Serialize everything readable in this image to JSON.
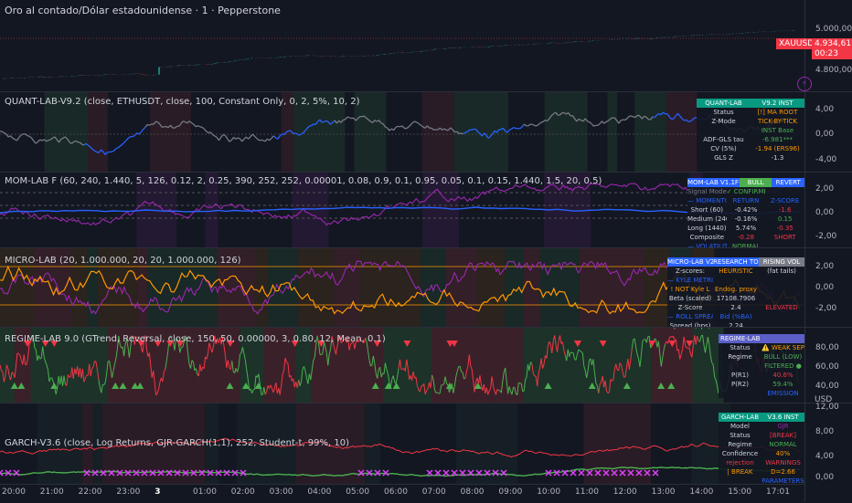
{
  "header": {
    "title": "Oro al contado/Dólar estadounidense · 1 · Pepperstone",
    "currency": "USD"
  },
  "price_pane": {
    "symbol": "XAUUSD",
    "last": "4.934,61",
    "countdown": "00:23",
    "ticks": [
      "5.000,00",
      "4.800,00"
    ]
  },
  "quant": {
    "title": "QUANT-LAB-V9.2 (close, ETHUSDT, close, 100, Constant Only, 0, 2, 5%, 10, 2)",
    "ticks": [
      "4,00",
      "0,00",
      "-4,00"
    ],
    "table": {
      "h1": "QUANT-LAB",
      "h2": "V9.2 INST",
      "rows": [
        [
          "Status",
          "[!] MA ROOT"
        ],
        [
          "Z-Mode",
          "TICK-BY-TICK"
        ],
        [
          "",
          "INST Base"
        ],
        [
          "ADF-GLS tau",
          "-6.981***"
        ],
        [
          "CV (5%)",
          "-1.94 (ERS96)"
        ],
        [
          "GLS Z",
          "-1.3"
        ]
      ]
    }
  },
  "mom": {
    "title": "MOM-LAB F (60, 240, 1.440, 5, 126, 0.12, 2, 0.25, 390, 252, 252, 0.00001, 0.08, 0.9, 0.1, 0.95, 0.05, 0.1, 0.15, 1.440, 1.5, 20, 0.5)",
    "ticks": [
      "2,00",
      "0,00",
      "-2,00"
    ],
    "table": {
      "h1": "MOM-LAB V1.1F-A",
      "h2": "BULL",
      "h3": "REVERT",
      "rows": [
        [
          "Signal Mode",
          "✓ CONFIRMED",
          ""
        ],
        [
          "— MOMENTUM —",
          "RETURN",
          "Z-SCORE"
        ],
        [
          "Short (60)",
          "-0.42%",
          "-1.6"
        ],
        [
          "Medium (240)",
          "-0.16%",
          "0.15"
        ],
        [
          "Long (1440)",
          "5.74%",
          "-0.35"
        ],
        [
          "Composite",
          "-0.28",
          "SHORT"
        ],
        [
          "— VOLATILITY —",
          "NORMAL",
          ""
        ]
      ]
    }
  },
  "micro": {
    "title": "MICRO-LAB (20, 1.000.000, 20, 20, 1.000.000, 126)",
    "ticks": [
      "2,00",
      "0,00",
      "-2,00"
    ],
    "table": {
      "h1": "MICRO-LAB V2.1",
      "h2": "RESEARCH TOOL",
      "h3": "RISING VOL",
      "rows": [
        [
          "Z-scores:",
          "HEURISTIC",
          "(fat tails)"
        ],
        [
          "— KYLE METRIC —",
          "",
          ""
        ],
        [
          "! NOT Kyle L",
          "Endog. proxy",
          ""
        ],
        [
          "Beta (scaled)",
          "17108.7906",
          ""
        ],
        [
          "Z-Score",
          "2.4",
          "ELEVATED"
        ],
        [
          "— ROLL SPREAD —",
          "Bid (%BA)",
          ""
        ],
        [
          "Spread (bps)",
          "2.24",
          ""
        ]
      ]
    }
  },
  "regime": {
    "title": "REGIME-LAB 9.0 (GTrend, Reversal, close, 150, 50, 0.00000, 3, 0.80, 12, Mean, 0.1)",
    "ticks": [
      "80,00",
      "60,00",
      "40,00",
      "20,00"
    ],
    "table": {
      "h1": "REGIME-LAB",
      "rows": [
        [
          "Status",
          "⚠️ WEAK SEP"
        ],
        [
          "Regime",
          "BULL (LOW)"
        ],
        [
          "",
          "FILTERED ●"
        ],
        [
          "P(R1)",
          "40.6%"
        ],
        [
          "P(R2)",
          "59.4%"
        ],
        [
          "",
          "EMISSION"
        ]
      ]
    }
  },
  "garch": {
    "title": "GARCH-V3.6 (close, Log Returns, GJR-GARCH(1,1), 252, Student-t, 99%, 10)",
    "ticks": [
      "12,00",
      "8,00",
      "4,00",
      "0,00"
    ],
    "table": {
      "h1": "GARCH-LAB",
      "h2": "V3.6 INST",
      "rows": [
        [
          "Model",
          "GJR"
        ],
        [
          "Status",
          "[BREAK]"
        ],
        [
          "Regime",
          "NORMAL"
        ],
        [
          "Confidence",
          "40%"
        ],
        [
          "rejection",
          "WARNINGS"
        ],
        [
          "| BREAK",
          "D=2.66"
        ],
        [
          "",
          "PARAMETERS"
        ]
      ]
    }
  },
  "time_axis": {
    "labels": [
      "20:00",
      "21:00",
      "22:00",
      "23:00",
      "3",
      "01:00",
      "02:00",
      "03:00",
      "04:00",
      "05:00",
      "06:00",
      "07:00",
      "08:00",
      "09:00",
      "10:00",
      "11:00",
      "12:00",
      "13:00",
      "14:00",
      "15:00",
      "17:01"
    ]
  },
  "colors": {
    "bg": "#131722",
    "up": "#26a69a",
    "down": "#ef5350",
    "blue": "#2962ff",
    "purple": "#9c27b0",
    "orange": "#ff9800",
    "green": "#4caf50",
    "red": "#f23645",
    "teal": "#089981"
  }
}
